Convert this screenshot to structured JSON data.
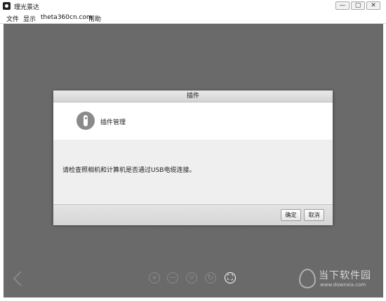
{
  "window": {
    "title": "理光景达",
    "min_label": "—",
    "max_label": "▢",
    "close_label": "✕"
  },
  "menu": [
    {
      "label": "文件"
    },
    {
      "label": "显示"
    },
    {
      "label": "theta360cn.com"
    },
    {
      "label": "帮助"
    }
  ],
  "dialog": {
    "title": "插件",
    "header_label": "插件管理",
    "message": "请检查照相机和计算机是否通过USB电缆连接。",
    "ok_label": "确定",
    "cancel_label": "取消"
  },
  "toolbar": {
    "icons": [
      "zoom-in-icon",
      "zoom-out-icon",
      "brightness-icon",
      "rotate-icon",
      "fullscreen-icon"
    ],
    "zoom_in_glyph": "+",
    "zoom_out_glyph": "−",
    "brightness_glyph": "☼",
    "rotate_glyph": "↻",
    "fullscreen_glyph": "⛶"
  },
  "watermark": {
    "text": "当下软件园",
    "url": "www.downxia.com"
  },
  "colors": {
    "stage": "#6a6a6a",
    "dialog_bg": "#ececec",
    "accent_icon": "#8a8a8a"
  }
}
